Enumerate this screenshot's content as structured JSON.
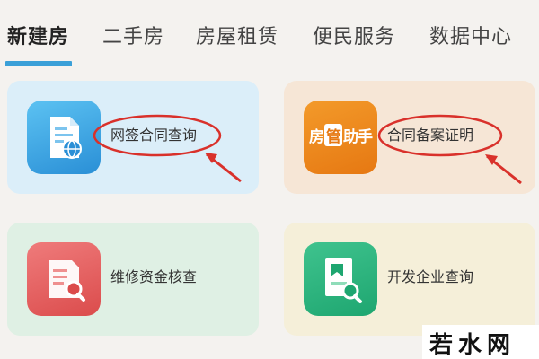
{
  "tabs": [
    {
      "label": "新建房",
      "active": true
    },
    {
      "label": "二手房",
      "active": false
    },
    {
      "label": "房屋租赁",
      "active": false
    },
    {
      "label": "便民服务",
      "active": false
    },
    {
      "label": "数据中心",
      "active": false
    }
  ],
  "cards": [
    {
      "label": "网签合同查询",
      "icon": "contract-globe-icon",
      "color": "#2a8fd6"
    },
    {
      "label": "合同备案证明",
      "icon": "fangguan-zhushou-icon",
      "icon_text": [
        "房",
        "管",
        "助手"
      ],
      "color": "#e67812"
    },
    {
      "label": "维修资金核查",
      "icon": "document-search-icon",
      "color": "#db4c4c"
    },
    {
      "label": "开发企业查询",
      "icon": "enterprise-search-icon",
      "color": "#1ea670"
    }
  ],
  "annotation_color": "#d9312b",
  "accent_color": "#3aa0d8",
  "watermark": "若水网"
}
